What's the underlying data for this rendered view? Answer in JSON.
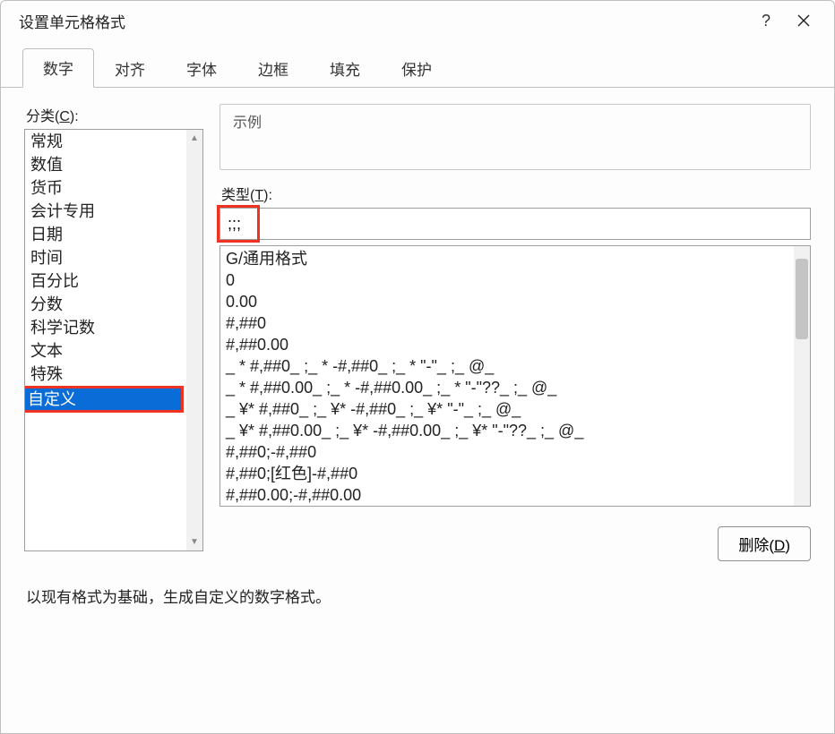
{
  "titlebar": {
    "title": "设置单元格格式",
    "help": "?",
    "close": "✕"
  },
  "tabs": [
    "数字",
    "对齐",
    "字体",
    "边框",
    "填充",
    "保护"
  ],
  "active_tab_index": 0,
  "category": {
    "label_prefix": "分类(",
    "label_key": "C",
    "label_suffix": "):",
    "items": [
      "常规",
      "数值",
      "货币",
      "会计专用",
      "日期",
      "时间",
      "百分比",
      "分数",
      "科学记数",
      "文本",
      "特殊",
      "自定义"
    ],
    "selected_index": 11
  },
  "example": {
    "label": "示例",
    "value": ""
  },
  "type": {
    "label_prefix": "类型(",
    "label_key": "T",
    "label_suffix": "):",
    "value": ";;;"
  },
  "formats": [
    "G/通用格式",
    "0",
    "0.00",
    "#,##0",
    "#,##0.00",
    "_ * #,##0_ ;_ * -#,##0_ ;_ * \"-\"_ ;_ @_ ",
    "_ * #,##0.00_ ;_ * -#,##0.00_ ;_ * \"-\"??_ ;_ @_ ",
    "_ ¥* #,##0_ ;_ ¥* -#,##0_ ;_ ¥* \"-\"_ ;_ @_ ",
    "_ ¥* #,##0.00_ ;_ ¥* -#,##0.00_ ;_ ¥* \"-\"??_ ;_ @_ ",
    "#,##0;-#,##0",
    "#,##0;[红色]-#,##0",
    "#,##0.00;-#,##0.00"
  ],
  "delete": {
    "label_prefix": "删除(",
    "label_key": "D",
    "label_suffix": ")"
  },
  "hint": "以现有格式为基础，生成自定义的数字格式。"
}
